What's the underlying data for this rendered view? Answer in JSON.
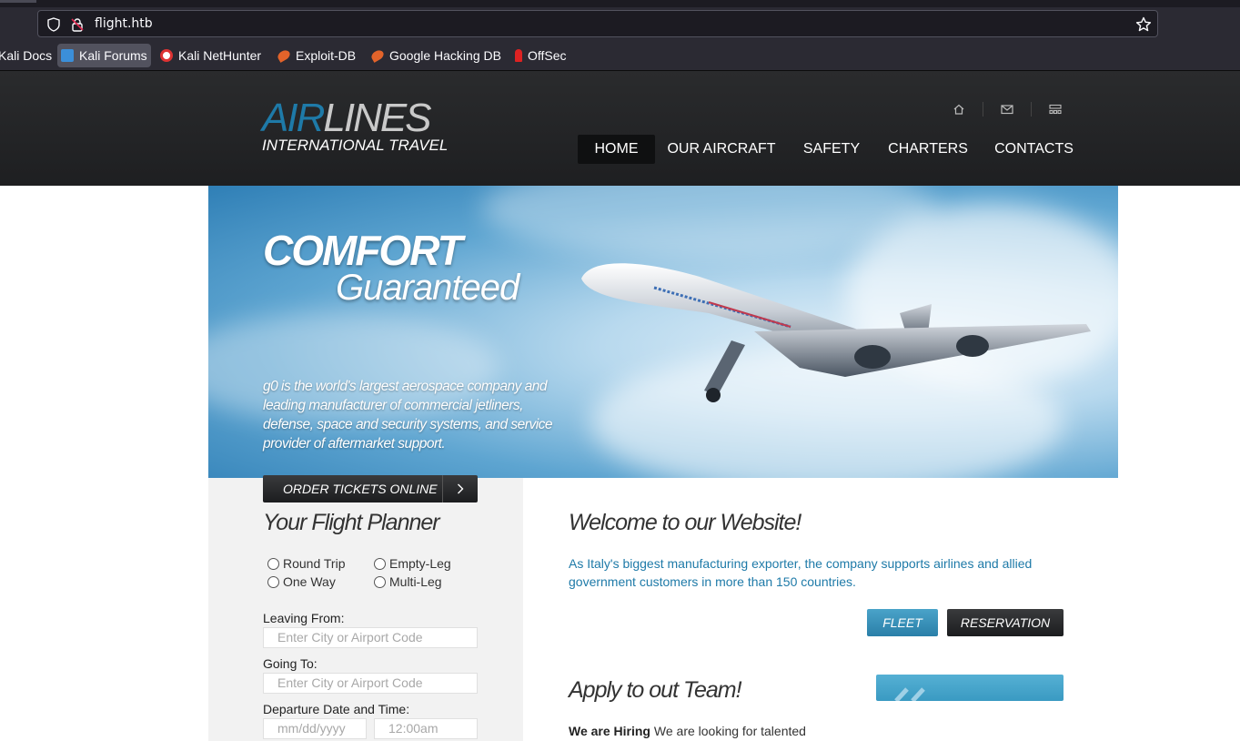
{
  "browser": {
    "url": "flight.htb",
    "bookmarks": [
      {
        "label": "Kali Docs"
      },
      {
        "label": "Kali Forums"
      },
      {
        "label": "Kali NetHunter"
      },
      {
        "label": "Exploit-DB"
      },
      {
        "label": "Google Hacking DB"
      },
      {
        "label": "OffSec"
      }
    ]
  },
  "header": {
    "logo_air": "AIR",
    "logo_lines": "LINES",
    "logo_tagline": "INTERNATIONAL TRAVEL",
    "nav": [
      "HOME",
      "OUR AIRCRAFT",
      "SAFETY",
      "CHARTERS",
      "CONTACTS"
    ],
    "active_nav": "HOME",
    "icons": [
      "home-icon",
      "mail-icon",
      "sitemap-icon"
    ]
  },
  "hero": {
    "title1": "COMFORT",
    "title2": "Guaranteed",
    "description": "g0 is the world's largest aerospace company and leading manufacturer of commercial jetliners, defense, space and security systems, and service provider of aftermarket support."
  },
  "planner": {
    "order_button": "ORDER TICKETS ONLINE",
    "title": "Your Flight Planner",
    "trip_types": [
      "Round Trip",
      "Empty-Leg",
      "One Way",
      "Multi-Leg"
    ],
    "leaving_label": "Leaving From:",
    "leaving_placeholder": "Enter City or Airport Code",
    "going_label": "Going To:",
    "going_placeholder": "Enter City or Airport Code",
    "departure_label": "Departure Date and Time:",
    "date_placeholder": "mm/dd/yyyy",
    "time_value": "12:00am"
  },
  "main": {
    "welcome_title": "Welcome to our Website!",
    "welcome_text": "As Italy's biggest manufacturing exporter, the company supports airlines and allied government customers in more than 150 countries.",
    "fleet_button": "FLEET",
    "reservation_button": "RESERVATION",
    "apply_title": "Apply to out Team!",
    "hiring_bold": "We are Hiring",
    "hiring_text": " We are looking for talented"
  },
  "colors": {
    "accent": "#1e7aa8",
    "header_bg": "#2a2b2d"
  }
}
